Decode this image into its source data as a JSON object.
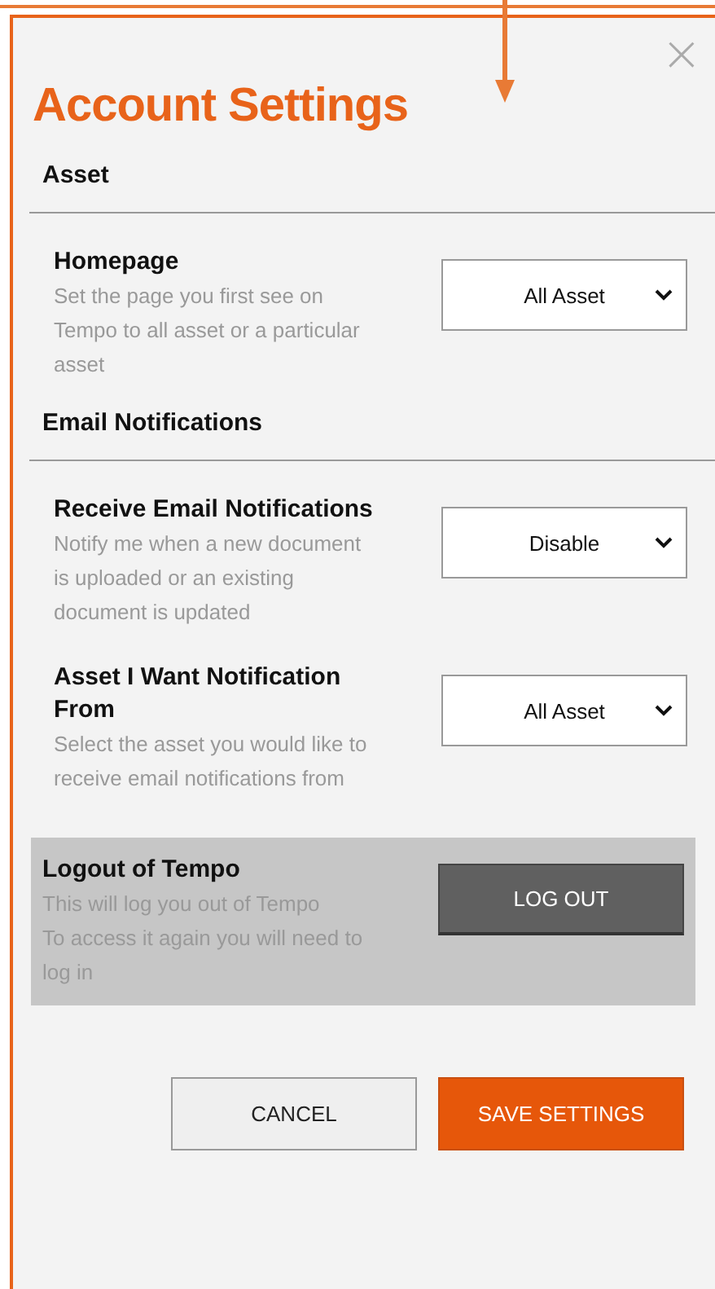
{
  "dialog": {
    "title": "Account Settings",
    "close": "×"
  },
  "sections": [
    {
      "heading": "Asset",
      "settings": [
        {
          "label": "Homepage",
          "description": "Set the page you first see on Tempo to all asset or a particular asset",
          "value": "All Asset"
        }
      ]
    },
    {
      "heading": "Email Notifications",
      "settings": [
        {
          "label": "Receive Email Notifications",
          "description": "Notify me when a new document is uploaded or an existing document is updated",
          "value": "Disable"
        },
        {
          "label": "Asset I Want Notification From",
          "description": "Select the asset you would like to receive email notifications from",
          "value": "All Asset"
        }
      ]
    }
  ],
  "logout": {
    "title": "Logout of Tempo",
    "lines": [
      "This will log you out of Tempo",
      "To access it again you will need to log in"
    ],
    "button": "LOG OUT"
  },
  "buttons": [
    {
      "kind": "secondary",
      "label": "CANCEL"
    },
    {
      "kind": "primary",
      "label": "SAVE SETTINGS"
    }
  ]
}
